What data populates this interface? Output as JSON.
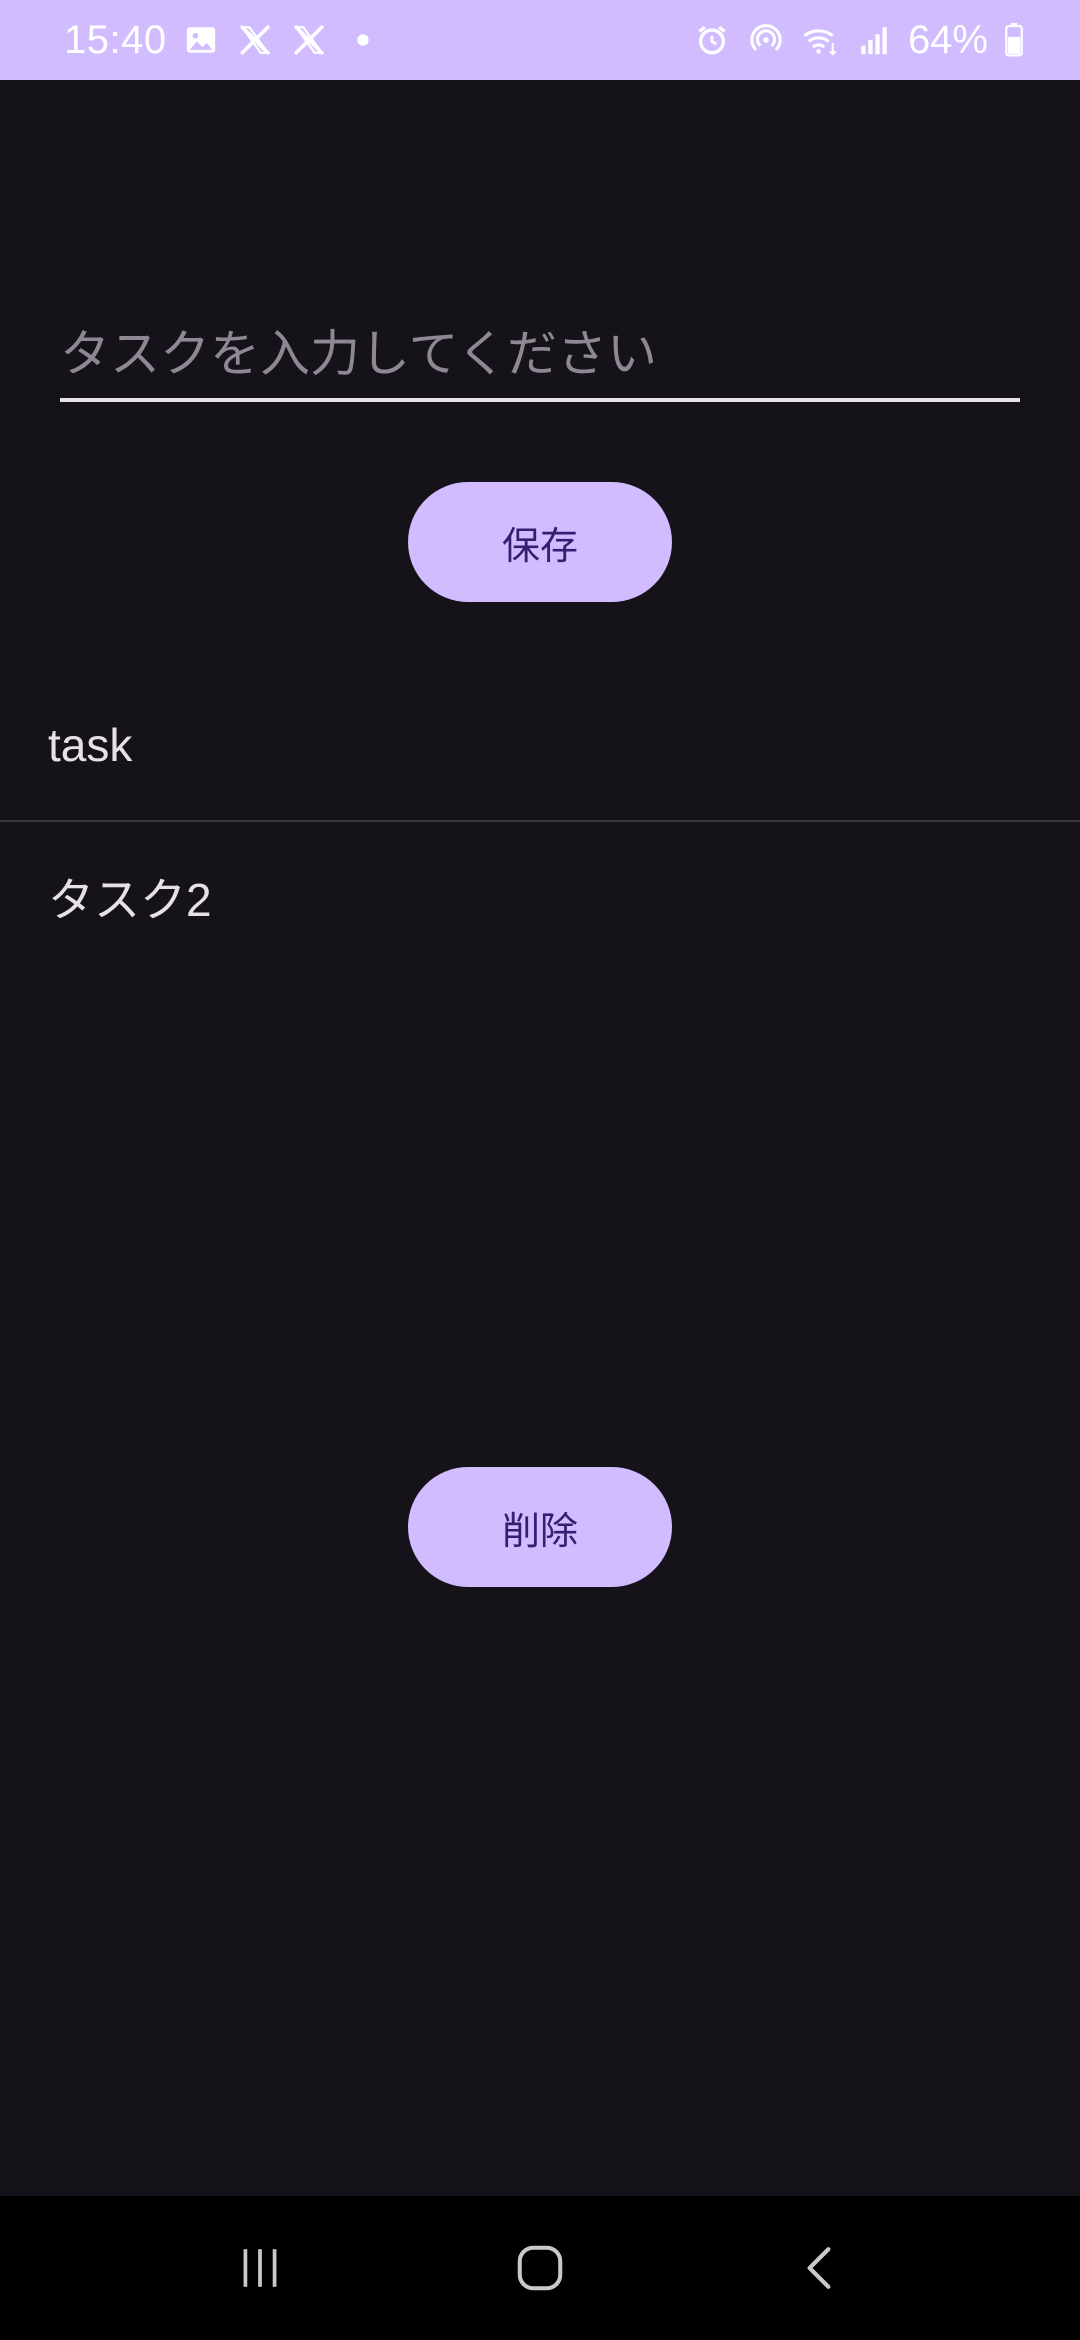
{
  "status_bar": {
    "time": "15:40",
    "battery": "64%",
    "left_icons": [
      "gallery-icon",
      "x-app-icon",
      "x-app-icon",
      "notification-dot-icon"
    ],
    "right_icons": [
      "alarm-icon",
      "hotspot-icon",
      "wifi-icon",
      "signal-icon",
      "battery-icon"
    ],
    "background_color": "#d0bcff"
  },
  "task_input": {
    "value": "",
    "placeholder": "タスクを入力してください"
  },
  "save_button": {
    "label": "保存"
  },
  "tasks": [
    {
      "label": "task"
    },
    {
      "label": "タスク2"
    }
  ],
  "delete_button": {
    "label": "削除"
  },
  "nav_bar": {
    "buttons": [
      "recent-apps-icon",
      "home-icon",
      "back-icon"
    ]
  },
  "colors": {
    "background": "#151219",
    "accent": "#d0bcff",
    "on_accent": "#381e72",
    "text": "#e6e0e9"
  }
}
